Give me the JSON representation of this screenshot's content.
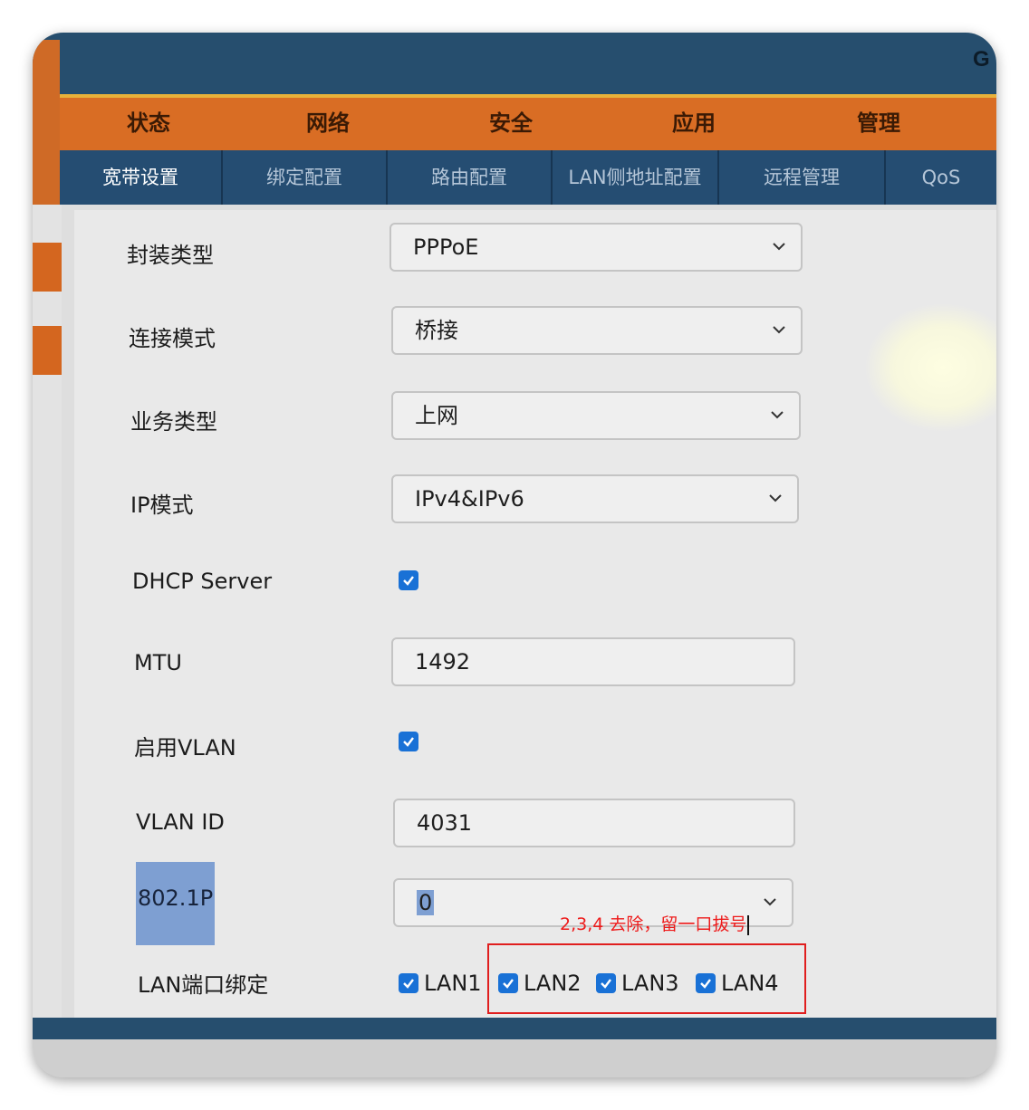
{
  "brand": "G",
  "main_nav": [
    "状态",
    "网络",
    "安全",
    "应用",
    "管理"
  ],
  "sub_nav": [
    "宽带设置",
    "绑定配置",
    "路由配置",
    "LAN侧地址配置",
    "远程管理",
    "QoS"
  ],
  "form": {
    "encap_label": "封装类型",
    "encap_value": "PPPoE",
    "conn_label": "连接模式",
    "conn_value": "桥接",
    "service_label": "业务类型",
    "service_value": "上网",
    "ipmode_label": "IP模式",
    "ipmode_value": "IPv4&IPv6",
    "dhcp_label": "DHCP Server",
    "dhcp_checked": true,
    "mtu_label": "MTU",
    "mtu_value": "1492",
    "vlan_enable_label": "启用VLAN",
    "vlan_enable_checked": true,
    "vlanid_label": "VLAN ID",
    "vlanid_value": "4031",
    "p8021_label": "802.1P",
    "p8021_value": "0",
    "lan_bind_label": "LAN端口绑定",
    "lan_ports": [
      {
        "label": "LAN1",
        "checked": true
      },
      {
        "label": "LAN2",
        "checked": true
      },
      {
        "label": "LAN3",
        "checked": true
      },
      {
        "label": "LAN4",
        "checked": true
      }
    ]
  },
  "annotation": {
    "text": "2,3,4 去除，留一口拔号",
    "color": "#ee1a1a"
  },
  "colors": {
    "nav_orange": "#d96d24",
    "nav_blue": "#254d72",
    "checkbox_blue": "#1971d6"
  }
}
